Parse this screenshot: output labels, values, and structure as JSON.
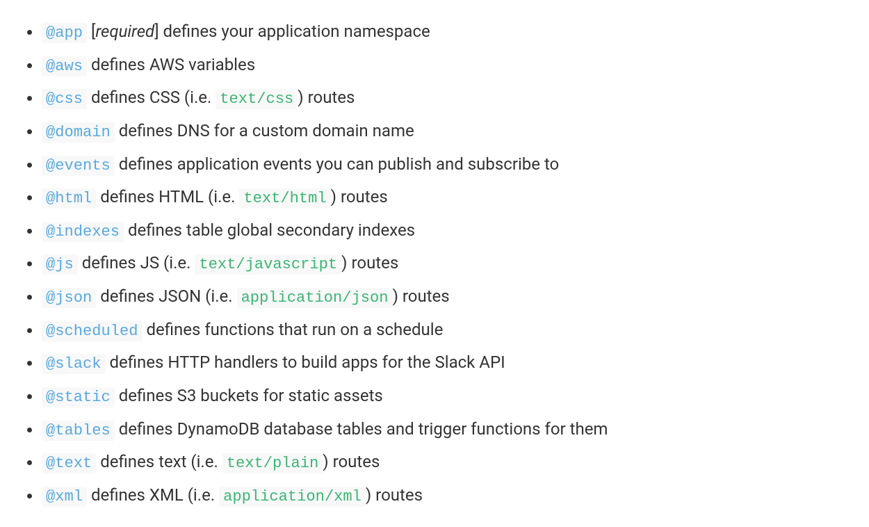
{
  "items": [
    {
      "directive": "@app",
      "required": true,
      "desc_before": " defines your application namespace",
      "mime": null,
      "desc_after": null
    },
    {
      "directive": "@aws",
      "required": false,
      "desc_before": " defines AWS variables",
      "mime": null,
      "desc_after": null
    },
    {
      "directive": "@css",
      "required": false,
      "desc_before": " defines CSS (i.e. ",
      "mime": "text/css",
      "desc_after": ") routes"
    },
    {
      "directive": "@domain",
      "required": false,
      "desc_before": " defines DNS for a custom domain name",
      "mime": null,
      "desc_after": null
    },
    {
      "directive": "@events",
      "required": false,
      "desc_before": " defines application events you can publish and subscribe to",
      "mime": null,
      "desc_after": null
    },
    {
      "directive": "@html",
      "required": false,
      "desc_before": " defines HTML (i.e. ",
      "mime": "text/html",
      "desc_after": ") routes"
    },
    {
      "directive": "@indexes",
      "required": false,
      "desc_before": " defines table global secondary indexes",
      "mime": null,
      "desc_after": null
    },
    {
      "directive": "@js",
      "required": false,
      "desc_before": " defines JS (i.e. ",
      "mime": "text/javascript",
      "desc_after": ") routes"
    },
    {
      "directive": "@json",
      "required": false,
      "desc_before": " defines JSON (i.e. ",
      "mime": "application/json",
      "desc_after": ") routes"
    },
    {
      "directive": "@scheduled",
      "required": false,
      "desc_before": " defines functions that run on a schedule",
      "mime": null,
      "desc_after": null
    },
    {
      "directive": "@slack",
      "required": false,
      "desc_before": " defines HTTP handlers to build apps for the Slack API",
      "mime": null,
      "desc_after": null
    },
    {
      "directive": "@static",
      "required": false,
      "desc_before": " defines S3 buckets for static assets",
      "mime": null,
      "desc_after": null
    },
    {
      "directive": "@tables",
      "required": false,
      "desc_before": " defines DynamoDB database tables and trigger functions for them",
      "mime": null,
      "desc_after": null
    },
    {
      "directive": "@text",
      "required": false,
      "desc_before": " defines text (i.e. ",
      "mime": "text/plain",
      "desc_after": ") routes"
    },
    {
      "directive": "@xml",
      "required": false,
      "desc_before": " defines XML (i.e. ",
      "mime": "application/xml",
      "desc_after": ") routes"
    }
  ],
  "required_label": "required"
}
